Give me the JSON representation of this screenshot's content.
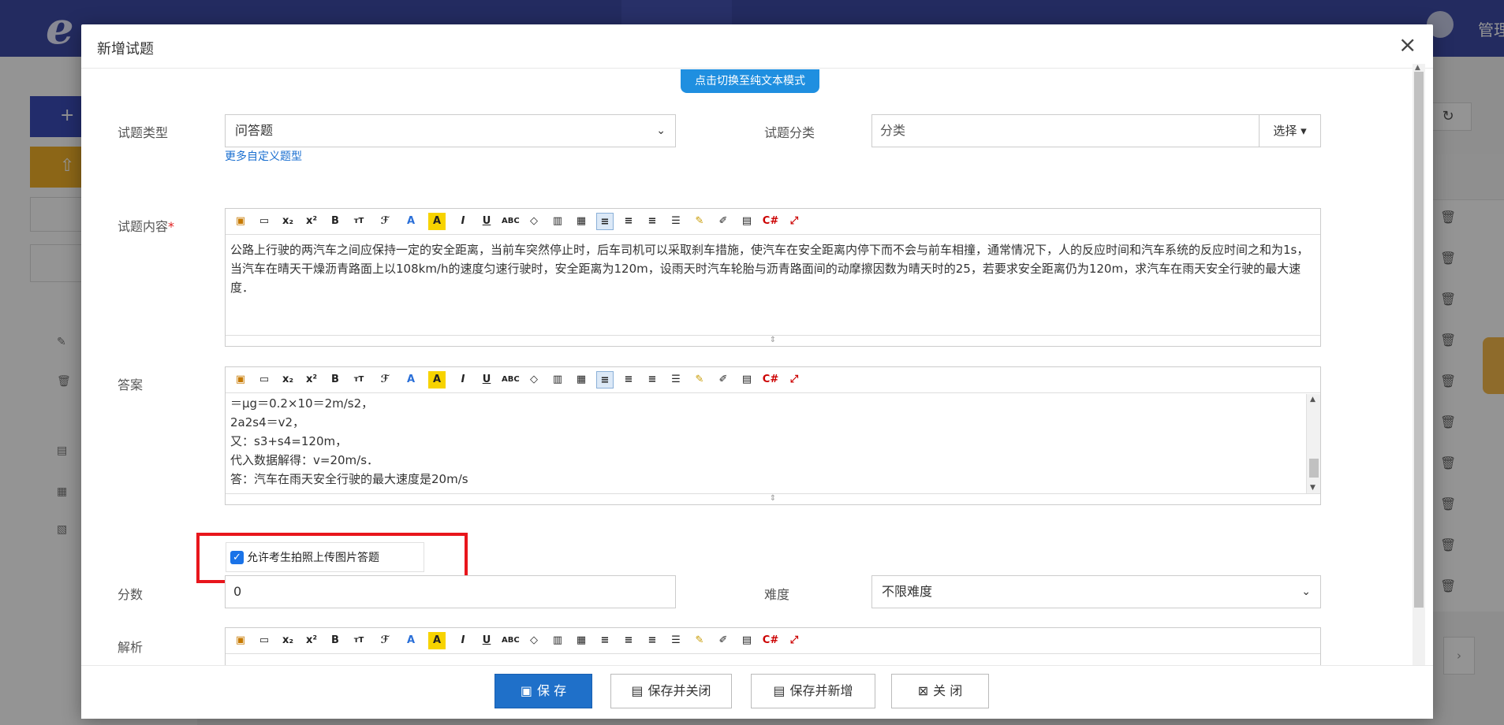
{
  "app": {
    "logo": "e",
    "admin_label": "管理"
  },
  "dialog": {
    "title": "新增试题",
    "close_glyph": "×",
    "toggle_mode_label": "点击切换至纯文本模式"
  },
  "form": {
    "type_label": "试题类型",
    "type_value": "问答题",
    "more_types_link": "更多自定义题型",
    "category_label": "试题分类",
    "category_placeholder": "分类",
    "category_select_button": "选择 ▾",
    "content_label": "试题内容",
    "required_mark": "*",
    "content_text": "公路上行驶的两汽车之间应保持一定的安全距离，当前车突然停止时，后车司机可以采取刹车措施，使汽车在安全距离内停下而不会与前车相撞，通常情况下，人的反应时间和汽车系统的反应时间之和为1s，当汽车在晴天干燥沥青路面上以108km/h的速度匀速行驶时，安全距离为120m，设雨天时汽车轮胎与沥青路面间的动摩擦因数为晴天时的25，若要求安全距离仍为120m，求汽车在雨天安全行驶的最大速度．",
    "answer_label": "答案",
    "answer_lines": [
      "＝μg＝0.2×10＝2m/s2，",
      "2a2s4＝v2，",
      "又：s3+s4=120m，",
      "代入数据解得：v=20m/s．",
      "答：汽车在雨天安全行驶的最大速度是20m/s"
    ],
    "allow_photo_label": "允许考生拍照上传图片答题",
    "allow_photo_checked": true,
    "score_label": "分数",
    "score_value": "0",
    "difficulty_label": "难度",
    "difficulty_value": "不限难度",
    "analysis_label": "解析"
  },
  "toolbar_icons": [
    "image-icon",
    "video-icon",
    "subscript-icon",
    "superscript-icon",
    "bold-icon",
    "font-size-icon",
    "font-family-icon",
    "font-color-icon",
    "highlight-icon",
    "italic-icon",
    "underline-icon",
    "strikethrough-icon",
    "eraser-icon",
    "paste-icon",
    "paste-word-icon",
    "align-left-icon",
    "align-center-icon",
    "align-right-icon",
    "list-icon",
    "brush-icon",
    "format-icon",
    "template-icon",
    "code-icon",
    "fullscreen-icon"
  ],
  "footer": {
    "save": "保 存",
    "save_close": "保存并关闭",
    "save_new": "保存并新增",
    "close": "关 闭"
  }
}
